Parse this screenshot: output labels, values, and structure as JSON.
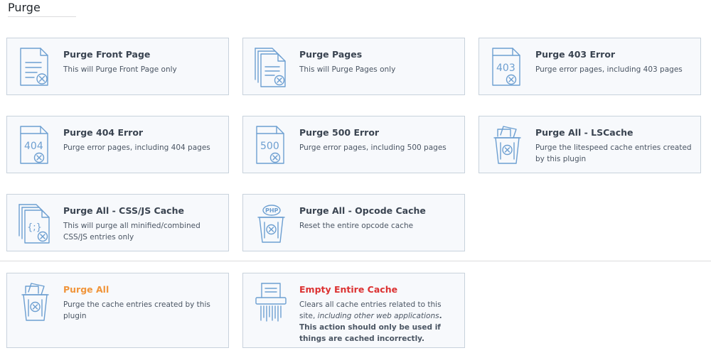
{
  "page": {
    "title": "Purge"
  },
  "cards": {
    "front_page": {
      "title": "Purge Front Page",
      "desc": "This will Purge Front Page only",
      "icon": "document-purge-icon"
    },
    "pages": {
      "title": "Purge Pages",
      "desc": "This will Purge Pages only",
      "icon": "pages-stack-purge-icon"
    },
    "e403": {
      "title": "Purge 403 Error",
      "desc": "Purge error pages, including 403 pages",
      "code": "403",
      "icon": "error-403-icon"
    },
    "e404": {
      "title": "Purge 404 Error",
      "desc": "Purge error pages, including 404 pages",
      "code": "404",
      "icon": "error-404-icon"
    },
    "e500": {
      "title": "Purge 500 Error",
      "desc": "Purge error pages, including 500 pages",
      "code": "500",
      "icon": "error-500-icon"
    },
    "lscache": {
      "title": "Purge All - LSCache",
      "desc": "Purge the litespeed cache entries created by this plugin",
      "icon": "trash-bin-icon"
    },
    "cssjs": {
      "title": "Purge All - CSS/JS Cache",
      "desc": "This will purge all minified/combined CSS/JS entries only",
      "code": "{;}",
      "icon": "css-js-cache-icon"
    },
    "opcode": {
      "title": "Purge All - Opcode Cache",
      "desc": "Reset the entire opcode cache",
      "code": "PHP",
      "icon": "php-trash-icon"
    },
    "all": {
      "title": "Purge All",
      "desc": "Purge the cache entries created by this plugin",
      "icon": "trash-bin-icon"
    },
    "empty": {
      "title": "Empty Entire Cache",
      "desc_1": "Clears all cache entries related to this site,",
      "desc_2": "including other web applications",
      "desc_3": ". This action should only be used if things are cached incorrectly.",
      "icon": "shredder-icon"
    }
  },
  "colors": {
    "icon": "#6d9fd1",
    "card_bg": "#f7f9fc",
    "card_border": "#c8d2dc",
    "orange": "#f0953b",
    "red": "#dc3232"
  }
}
